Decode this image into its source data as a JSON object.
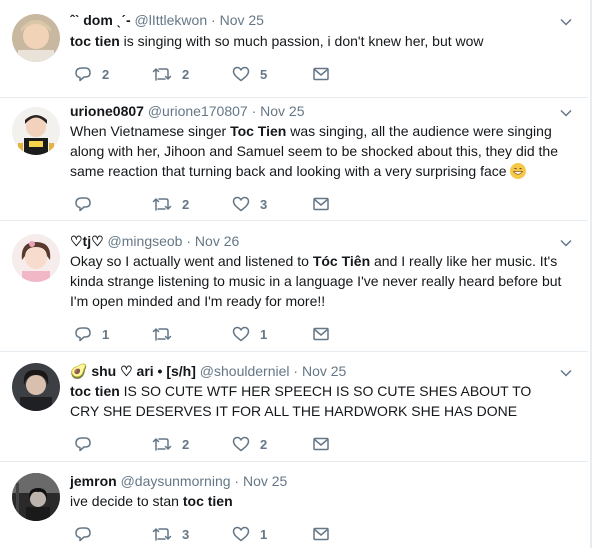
{
  "colors": {
    "text": "#14171a",
    "muted": "#657786",
    "divider": "#e6ecf0"
  },
  "tweets": [
    {
      "name": "ˆˋ dom ˎˊ-",
      "handle": "@lIttlekwon",
      "dot": "·",
      "time": "Nov 25",
      "text_parts": [
        {
          "t": "toc tien",
          "b": true
        },
        {
          "t": " is singing with so much passion, i don't knew her, but wow",
          "b": false
        }
      ],
      "counts": {
        "reply": "2",
        "retweet": "2",
        "like": "5"
      }
    },
    {
      "name": "urione0807",
      "handle": "@urione170807",
      "dot": "·",
      "time": "Nov 25",
      "text_parts": [
        {
          "t": "When Vietnamese singer ",
          "b": false
        },
        {
          "t": "Toc Tien",
          "b": true
        },
        {
          "t": " was singing, all the audience were singing along with her, Jihoon and Samuel seem to be shocked about this, they did the same reaction that turning back and looking with a very surprising face ",
          "b": false
        }
      ],
      "emoji": "grinning-face-emoji",
      "counts": {
        "reply": "",
        "retweet": "2",
        "like": "3"
      }
    },
    {
      "name": "♡tj♡",
      "handle": "@mingseob",
      "dot": "·",
      "time": "Nov 26",
      "text_parts": [
        {
          "t": "Okay so I actually went and listened to ",
          "b": false
        },
        {
          "t": "Tóc Tiên",
          "b": true
        },
        {
          "t": " and I really like her music. It's kinda strange listening to music in a language I've never really heard before but I'm open minded and I'm ready for more!!",
          "b": false
        }
      ],
      "counts": {
        "reply": "1",
        "retweet": "",
        "like": "1"
      }
    },
    {
      "name": "🥑 shu ♡ ari • [s/h]",
      "handle": "@shoulderniel",
      "dot": "·",
      "time": "Nov 25",
      "text_parts": [
        {
          "t": "toc tien",
          "b": true
        },
        {
          "t": " IS SO CUTE WTF HER SPEECH IS SO CUTE SHES ABOUT TO CRY SHE DESERVES IT FOR ALL THE HARDWORK SHE HAS DONE",
          "b": false
        }
      ],
      "counts": {
        "reply": "",
        "retweet": "2",
        "like": "2"
      }
    },
    {
      "name": "jemron",
      "handle": "@daysunmorning",
      "dot": "·",
      "time": "Nov 25",
      "text_parts": [
        {
          "t": "ive decide to stan ",
          "b": false
        },
        {
          "t": "toc tien",
          "b": true
        }
      ],
      "counts": {
        "reply": "",
        "retweet": "3",
        "like": "1"
      }
    }
  ]
}
